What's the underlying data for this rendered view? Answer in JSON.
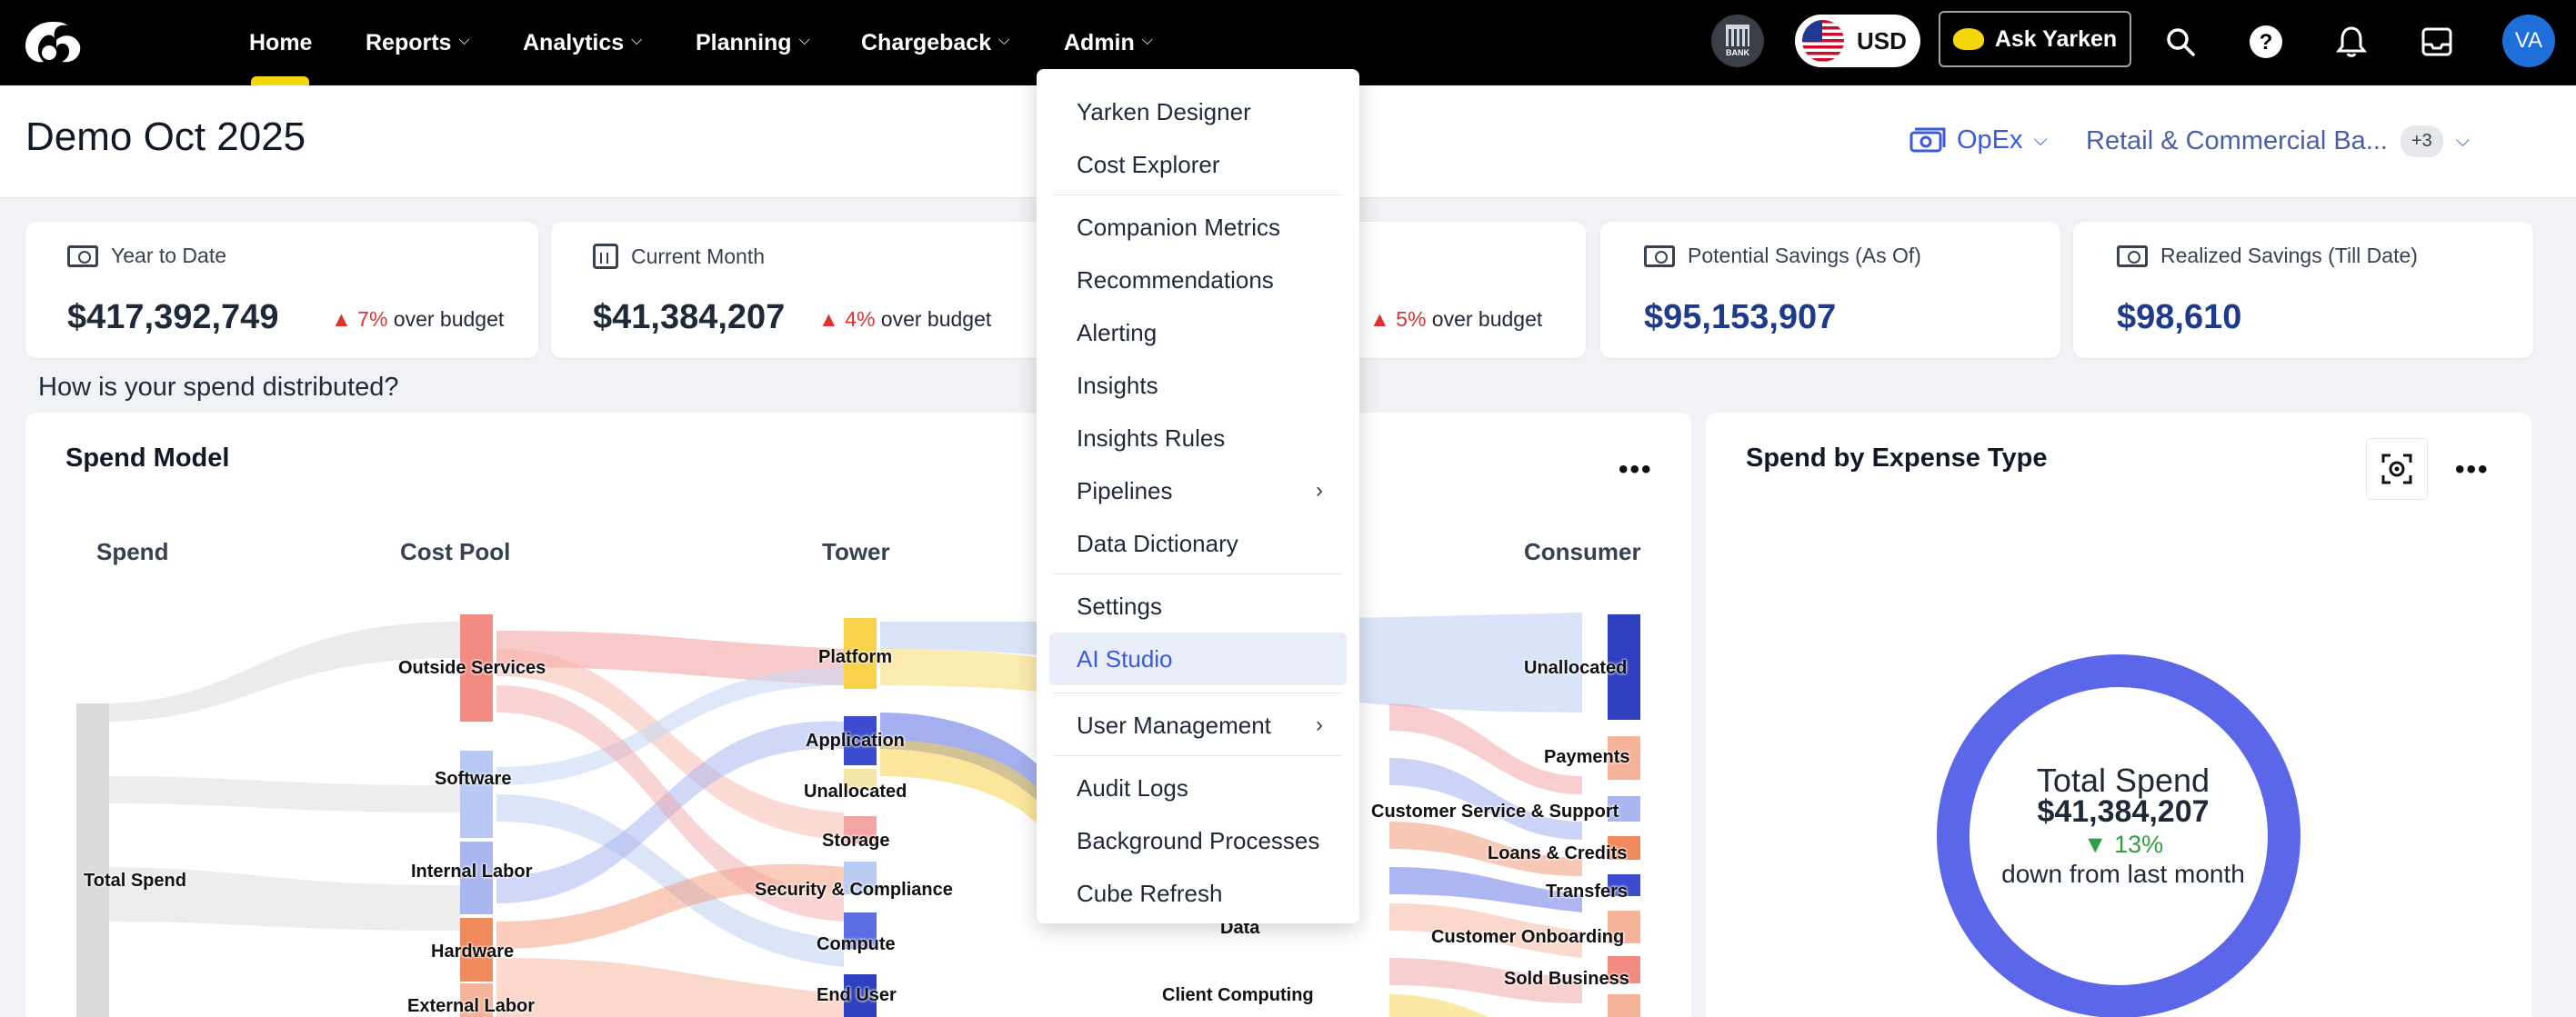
{
  "nav": {
    "items": [
      "Home",
      "Reports",
      "Analytics",
      "Planning",
      "Chargeback",
      "Admin"
    ],
    "bank_label": "BANK",
    "currency": "USD",
    "ask_label": "Ask Yarken",
    "avatar": "VA"
  },
  "header": {
    "title": "Demo Oct 2025",
    "opex": "OpEx",
    "scope": "Retail & Commercial Ba...",
    "scope_extra": "+3"
  },
  "kpis": [
    {
      "label": "Year to Date",
      "value": "$417,392,749",
      "delta": "7%",
      "delta_text": " over budget"
    },
    {
      "label": "Current Month",
      "value": "$41,384,207",
      "delta": "4%",
      "delta_text": " over budget"
    },
    {
      "label": "",
      "value": "",
      "delta": "5%",
      "delta_text": " over budget"
    },
    {
      "label": "Potential Savings (As Of)",
      "value": "$95,153,907"
    },
    {
      "label": "Realized Savings (Till Date)",
      "value": "$98,610"
    }
  ],
  "section_question": "How is your spend distributed?",
  "spend_model": {
    "title": "Spend Model",
    "columns": [
      "Spend",
      "Cost Pool",
      "Tower",
      "Consumer"
    ],
    "spend_nodes": [
      "Total Spend"
    ],
    "cost_pool_nodes": [
      "Outside Services",
      "Software",
      "Internal Labor",
      "Hardware",
      "External Labor"
    ],
    "tower_nodes": [
      "Platform",
      "Application",
      "Unallocated",
      "Storage",
      "Security & Compliance",
      "Compute",
      "End User"
    ],
    "app_nodes": [
      "Data",
      "Client Computing"
    ],
    "consumer_nodes": [
      "Unallocated",
      "Payments",
      "Customer Service & Support",
      "Loans & Credits",
      "Transfers",
      "Customer Onboarding",
      "Sold Business"
    ]
  },
  "expense": {
    "title": "Spend by Expense Type",
    "center_title": "Total Spend",
    "center_value": "$41,384,207",
    "center_delta": "▼ 13%",
    "center_sub": "down from last month"
  },
  "admin_menu": {
    "items": [
      "Yarken Designer",
      "Cost Explorer",
      "Companion Metrics",
      "Recommendations",
      "Alerting",
      "Insights",
      "Insights Rules",
      "Pipelines",
      "Data Dictionary",
      "Settings",
      "AI Studio",
      "User Management",
      "Audit Logs",
      "Background Processes",
      "Cube Refresh"
    ],
    "active": "AI Studio"
  },
  "colors": {
    "accent": "#3b5bdb",
    "brand_yellow": "#f5d60a",
    "donut": "#5b67e8",
    "up": "#e03131",
    "down": "#2f9e44"
  }
}
